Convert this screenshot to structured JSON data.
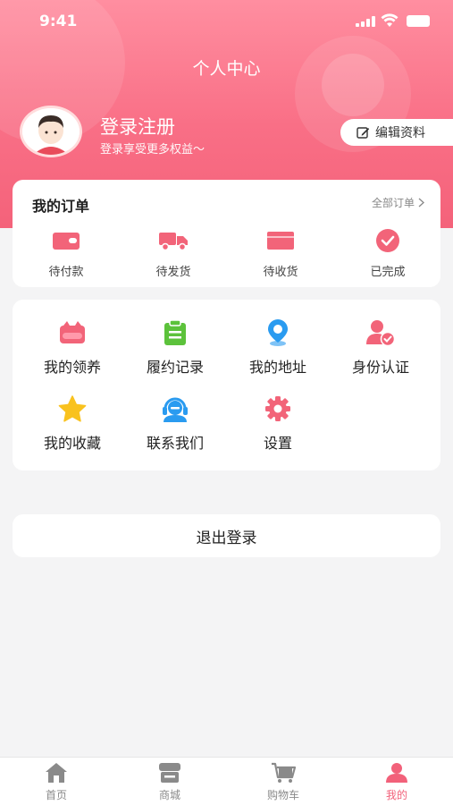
{
  "status_bar": {
    "time": "9:41"
  },
  "header": {
    "title": "个人中心"
  },
  "profile": {
    "name": "登录注册",
    "subtitle": "登录享受更多权益～",
    "edit_label": "编辑资料"
  },
  "orders": {
    "title": "我的订单",
    "all_label": "全部订单",
    "items": [
      {
        "label": "待付款",
        "icon": "wallet-icon"
      },
      {
        "label": "待发货",
        "icon": "truck-icon"
      },
      {
        "label": "待收货",
        "icon": "box-icon"
      },
      {
        "label": "已完成",
        "icon": "check-circle-icon"
      }
    ]
  },
  "services": {
    "items": [
      {
        "label": "我的领养",
        "icon": "adoption-icon"
      },
      {
        "label": "履约记录",
        "icon": "clipboard-icon"
      },
      {
        "label": "我的地址",
        "icon": "location-pin-icon"
      },
      {
        "label": "身份认证",
        "icon": "user-verified-icon"
      },
      {
        "label": "我的收藏",
        "icon": "star-icon"
      },
      {
        "label": "联系我们",
        "icon": "headset-icon"
      },
      {
        "label": "设置",
        "icon": "gear-icon"
      }
    ]
  },
  "logout_label": "退出登录",
  "tabbar": {
    "items": [
      {
        "label": "首页",
        "icon": "home-icon"
      },
      {
        "label": "商城",
        "icon": "store-icon"
      },
      {
        "label": "购物车",
        "icon": "cart-icon"
      },
      {
        "label": "我的",
        "icon": "profile-icon"
      }
    ],
    "active": "我的"
  },
  "colors": {
    "accent": "#f4627a",
    "hero_top": "#ff8ea0",
    "background": "#f4f4f5"
  }
}
